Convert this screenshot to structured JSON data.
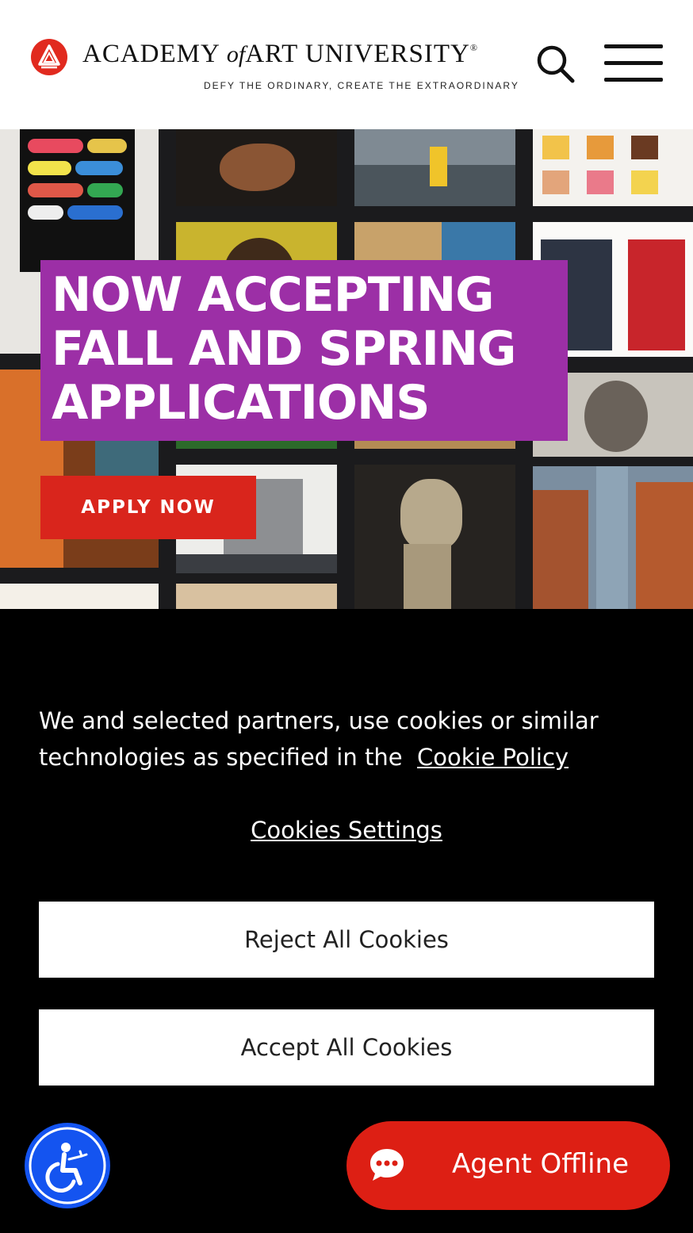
{
  "header": {
    "brand_prefix": "ACADEMY",
    "brand_of": "of",
    "brand_suffix": "ART UNIVERSITY",
    "brand_mark": "®",
    "tagline": "DEFY THE ORDINARY, CREATE THE EXTRAORDINARY",
    "logo_icon": "academy-logo-icon",
    "search_icon": "search-icon",
    "menu_icon": "hamburger-menu-icon"
  },
  "hero": {
    "headline": "NOW ACCEPTING\nFALL AND SPRING\nAPPLICATIONS",
    "cta_label": "APPLY NOW"
  },
  "cookie_banner": {
    "text": "We and selected partners, use cookies or similar technologies as specified in the",
    "policy_link": "Cookie Policy",
    "settings_link": "Cookies Settings",
    "reject_label": "Reject All Cookies",
    "accept_label": "Accept All Cookies"
  },
  "widgets": {
    "accessibility_icon": "accessibility-icon",
    "chat_icon": "chat-bubble-icon",
    "agent_status": "Agent Offline"
  },
  "colors": {
    "brand_red": "#d9251c",
    "headline_purple": "#9c2fa6",
    "accessibility_blue": "#1454f0",
    "agent_red": "#dd1f14"
  }
}
